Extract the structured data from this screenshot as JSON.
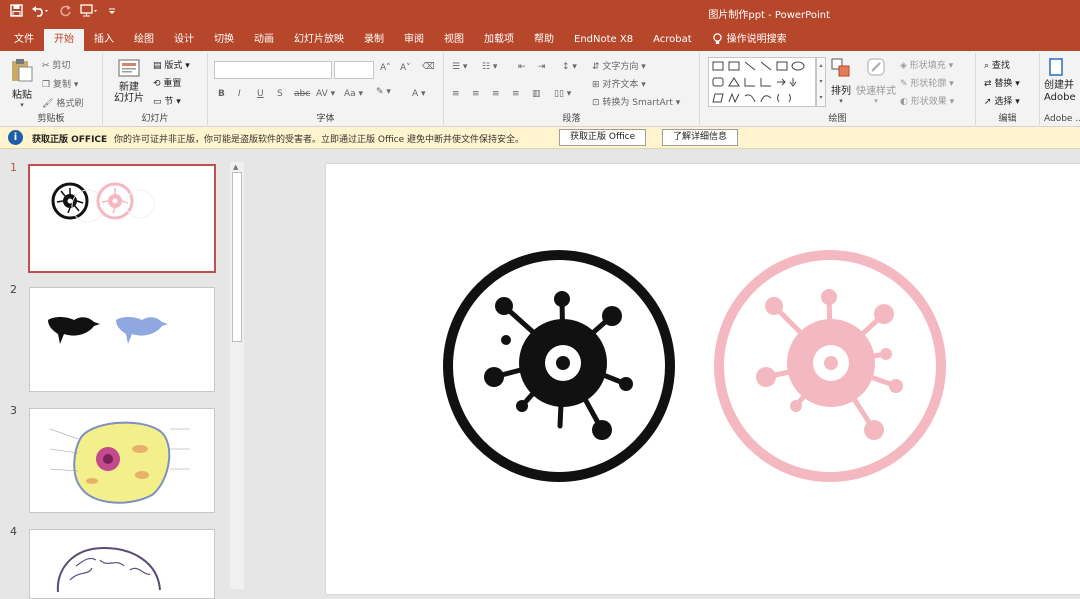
{
  "window": {
    "title": "图片制作ppt  -  PowerPoint"
  },
  "tabs": [
    "文件",
    "开始",
    "插入",
    "绘图",
    "设计",
    "切换",
    "动画",
    "幻灯片放映",
    "录制",
    "审阅",
    "视图",
    "加载项",
    "帮助",
    "EndNote X8",
    "Acrobat",
    "操作说明搜索"
  ],
  "ribbon": {
    "clipboard": {
      "paste": "粘贴",
      "cut": "剪切",
      "copy": "复制",
      "format_painter": "格式刷",
      "label": "剪贴板"
    },
    "slides": {
      "new_slide": "新建\n幻灯片",
      "layout": "版式",
      "reset": "重置",
      "section": "节",
      "label": "幻灯片"
    },
    "font": {
      "bold": "B",
      "italic": "I",
      "underline": "U",
      "shadow": "S",
      "strike": "abc",
      "spacing": "AV",
      "case": "Aa",
      "color": "A",
      "grow": "A",
      "shrink": "A",
      "label": "字体"
    },
    "paragraph": {
      "text_direction": "文字方向",
      "align_text": "对齐文本",
      "smartart": "转换为 SmartArt",
      "label": "段落"
    },
    "drawing": {
      "arrange": "排列",
      "quick_styles": "快速样式",
      "shape_fill": "形状填充",
      "shape_outline": "形状轮廓",
      "shape_effects": "形状效果",
      "label": "绘图"
    },
    "editing": {
      "find": "查找",
      "replace": "替换",
      "select": "选择",
      "label": "编辑"
    },
    "adobe": {
      "create": "创建并",
      "adobe": "Adobe",
      "label": "Adobe ..."
    }
  },
  "message_bar": {
    "title": "获取正版 OFFICE",
    "text": "你的许可证并非正版，你可能是盗版软件的受害者。立即通过正版 Office 避免中断并使文件保持安全。",
    "button1": "获取正版 Office",
    "button2": "了解详细信息"
  },
  "thumbnails": [
    {
      "number": "1"
    },
    {
      "number": "2"
    },
    {
      "number": "3"
    },
    {
      "number": "4"
    }
  ],
  "colors": {
    "accent": "#b7472a",
    "virus_dark": "#111111",
    "virus_pink": "#f4b8c1",
    "bird_blue": "#8fa8e0"
  }
}
